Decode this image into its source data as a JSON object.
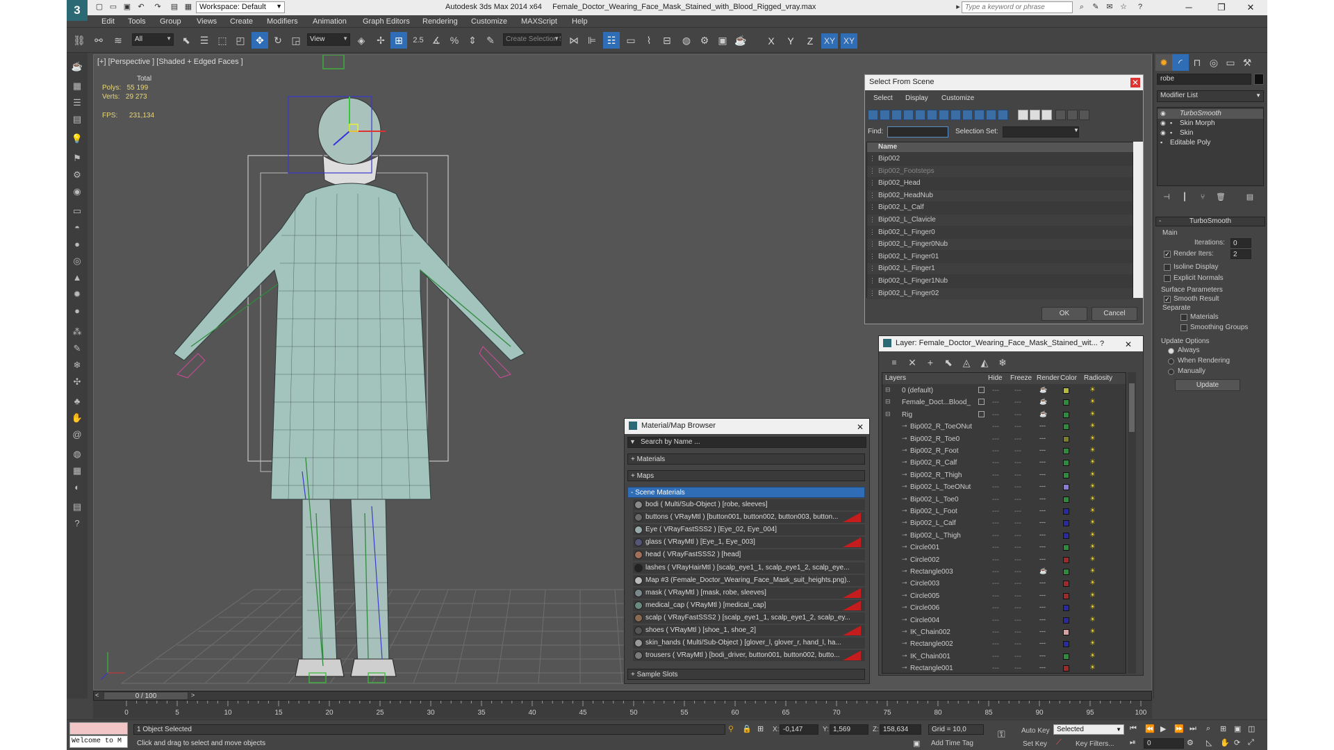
{
  "titlebar": {
    "app": "Autodesk 3ds Max  2014 x64",
    "file": "Female_Doctor_Wearing_Face_Mask_Stained_with_Blood_Rigged_vray.max",
    "workspace": "Workspace: Default",
    "search_placeholder": "Type a keyword or phrase"
  },
  "menu": [
    "Edit",
    "Tools",
    "Group",
    "Views",
    "Create",
    "Modifiers",
    "Animation",
    "Graph Editors",
    "Rendering",
    "Customize",
    "MAXScript",
    "Help"
  ],
  "toolbar": {
    "filter": "All",
    "refcoord": "View",
    "selection_set": "Create Selection Se",
    "snap_value": "2.5",
    "axes": [
      "X",
      "Y",
      "Z",
      "XY",
      "XY"
    ]
  },
  "viewport": {
    "label": "[+] [Perspective ] [Shaded + Edged Faces ]",
    "stats": {
      "total_label": "Total",
      "polys_label": "Polys:",
      "polys": "55 199",
      "verts_label": "Verts:",
      "verts": "29 273",
      "fps_label": "FPS:",
      "fps": "231,134"
    }
  },
  "select_dialog": {
    "title": "Select From Scene",
    "menu": [
      "Select",
      "Display",
      "Customize"
    ],
    "find_label": "Find:",
    "selset_label": "Selection Set:",
    "column": "Name",
    "items": [
      "Bip002",
      "Bip002_Footsteps",
      "Bip002_Head",
      "Bip002_HeadNub",
      "Bip002_L_Calf",
      "Bip002_L_Clavicle",
      "Bip002_L_Finger0",
      "Bip002_L_Finger0Nub",
      "Bip002_L_Finger01",
      "Bip002_L_Finger1",
      "Bip002_L_Finger1Nub",
      "Bip002_L_Finger02"
    ],
    "ok": "OK",
    "cancel": "Cancel"
  },
  "layer_dialog": {
    "title": "Layer: Female_Doctor_Wearing_Face_Mask_Stained_wit...",
    "help": "?",
    "columns": [
      "Layers",
      "Hide",
      "Freeze",
      "Render",
      "Color",
      "Radiosity"
    ],
    "rows": [
      {
        "name": "0 (default)",
        "color": "#b8b83a",
        "indent": 0
      },
      {
        "name": "Female_Doct...Blood_",
        "color": "#2e8b3c",
        "indent": 0
      },
      {
        "name": "Rig",
        "color": "#2e8b3c",
        "indent": 0
      },
      {
        "name": "Bip002_R_ToeONut",
        "color": "#2e8b3c",
        "indent": 1
      },
      {
        "name": "Bip002_R_Toe0",
        "color": "#7d7d2a",
        "indent": 1
      },
      {
        "name": "Bip002_R_Foot",
        "color": "#2e8b3c",
        "indent": 1
      },
      {
        "name": "Bip002_R_Calf",
        "color": "#2e8b3c",
        "indent": 1
      },
      {
        "name": "Bip002_R_Thigh",
        "color": "#2e8b3c",
        "indent": 1
      },
      {
        "name": "Bip002_L_ToeONut",
        "color": "#8c7bd6",
        "indent": 1
      },
      {
        "name": "Bip002_L_Toe0",
        "color": "#2e8b3c",
        "indent": 1
      },
      {
        "name": "Bip002_L_Foot",
        "color": "#2a2aa0",
        "indent": 1
      },
      {
        "name": "Bip002_L_Calf",
        "color": "#2a2aa0",
        "indent": 1
      },
      {
        "name": "Bip002_L_Thigh",
        "color": "#2a2aa0",
        "indent": 1
      },
      {
        "name": "Circle001",
        "color": "#2e8b3c",
        "indent": 1
      },
      {
        "name": "Circle002",
        "color": "#a02a2a",
        "indent": 1
      },
      {
        "name": "Rectangle003",
        "color": "#2e8b3c",
        "indent": 1
      },
      {
        "name": "Circle003",
        "color": "#a02a2a",
        "indent": 1
      },
      {
        "name": "Circle005",
        "color": "#a02a2a",
        "indent": 1
      },
      {
        "name": "Circle006",
        "color": "#2a2aa0",
        "indent": 1
      },
      {
        "name": "Circle004",
        "color": "#2a2aa0",
        "indent": 1
      },
      {
        "name": "IK_Chain002",
        "color": "#d8a0a0",
        "indent": 1
      },
      {
        "name": "Rectangle002",
        "color": "#2a2aa0",
        "indent": 1
      },
      {
        "name": "IK_Chain001",
        "color": "#2e8b3c",
        "indent": 1
      },
      {
        "name": "Rectangle001",
        "color": "#a02a2a",
        "indent": 1
      }
    ]
  },
  "material_browser": {
    "title": "Material/Map Browser",
    "search_placeholder": "Search by Name ...",
    "groups": [
      "+ Materials",
      "+ Maps",
      "- Scene Materials",
      "+ Sample Slots"
    ],
    "items": [
      {
        "text": "bodi  ( Multi/Sub-Object ) [robe, sleeves]",
        "swatch": "#8a8a8a",
        "red": false
      },
      {
        "text": "buttons  ( VRayMtl ) [button001, button002, button003, button...",
        "swatch": "#6a6a6a",
        "red": true
      },
      {
        "text": "Eye  ( VRayFastSSS2 ) [Eye_02, Eye_004]",
        "swatch": "#9aa",
        "red": false
      },
      {
        "text": "glass  ( VRayMtl ) [Eye_1, Eye_003]",
        "swatch": "#557",
        "red": true
      },
      {
        "text": "head  ( VRayFastSSS2 ) [head]",
        "swatch": "#a0705a",
        "red": false
      },
      {
        "text": "lashes  ( VRayHairMtl ) [scalp_eye1_1, scalp_eye1_2, scalp_eye...",
        "swatch": "#222",
        "red": false
      },
      {
        "text": "Map #3 (Female_Doctor_Wearing_Face_Mask_suit_heights.png)...",
        "swatch": "#bbb",
        "red": false
      },
      {
        "text": "mask  ( VRayMtl ) [mask, robe, sleeves]",
        "swatch": "#7a8a8a",
        "red": true
      },
      {
        "text": "medical_cap  ( VRayMtl ) [medical_cap]",
        "swatch": "#6a8a80",
        "red": true
      },
      {
        "text": "scalp  ( VRayFastSSS2 ) [scalp_eye1_1, scalp_eye1_2, scalp_ey...",
        "swatch": "#8a6a50",
        "red": false
      },
      {
        "text": "shoes  ( VRayMtl ) [shoe_1, shoe_2]",
        "swatch": "#555",
        "red": true
      },
      {
        "text": "skin_hands  ( Multi/Sub-Object ) [glover_l, glover_r, hand_l, ha...",
        "swatch": "#999",
        "red": false
      },
      {
        "text": "trousers  ( VRayMtl ) [bodi_driver, button001, button002, butto...",
        "swatch": "#7a7a7a",
        "red": true
      }
    ]
  },
  "command_panel": {
    "object_name": "robe",
    "modifier_list": "Modifier List",
    "stack": [
      "TurboSmooth",
      "Skin Morph",
      "Skin",
      "Editable Poly"
    ],
    "rollout": "TurboSmooth",
    "main": "Main",
    "iterations_label": "Iterations:",
    "iterations": "0",
    "render_iters_label": "Render Iters:",
    "render_iters": "2",
    "isoline": "Isoline Display",
    "explicit": "Explicit Normals",
    "surface": "Surface Parameters",
    "smooth_result": "Smooth Result",
    "separate": "Separate",
    "materials": "Materials",
    "smoothing_groups": "Smoothing Groups",
    "update_options": "Update Options",
    "always": "Always",
    "when_rendering": "When Rendering",
    "manually": "Manually",
    "update": "Update"
  },
  "timeline": {
    "frame": "0 / 100",
    "ticks": [
      "0",
      "5",
      "10",
      "15",
      "20",
      "25",
      "30",
      "35",
      "40",
      "45",
      "50",
      "55",
      "60",
      "65",
      "70",
      "75",
      "80",
      "85",
      "90",
      "95",
      "100"
    ]
  },
  "status": {
    "listener": "Welcome to M",
    "selected": "1 Object Selected",
    "prompt": "Click and drag to select and move objects",
    "x_label": "X:",
    "x": "-0,147",
    "y_label": "Y:",
    "y": "1,569",
    "z_label": "Z:",
    "z": "158,634",
    "grid": "Grid = 10,0",
    "auto_key": "Auto Key",
    "set_key": "Set Key",
    "selected_combo": "Selected",
    "key_filters": "Key Filters...",
    "add_time_tag": "Add Time Tag",
    "frame_field": "0"
  }
}
